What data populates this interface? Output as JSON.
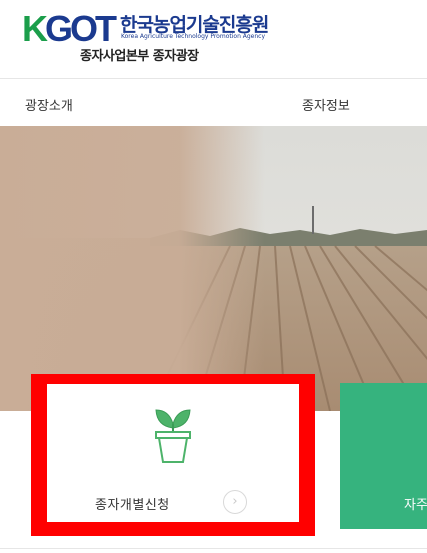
{
  "header": {
    "logo_mark_k": "K",
    "logo_mark_rest": "GOT",
    "org_name_kr": "한국농업기술진흥원",
    "org_name_en": "Korea Agriculture Technology Promotion Agency",
    "subtitle": "종자사업본부 종자광장"
  },
  "nav": {
    "items": [
      {
        "label": "광장소개"
      },
      {
        "label": "종자정보"
      }
    ]
  },
  "cards": [
    {
      "label": "종자개별신청",
      "icon": "seedling-pot-icon",
      "arrow": "›"
    },
    {
      "label": "자주"
    }
  ],
  "colors": {
    "brand_green": "#1b9e4b",
    "brand_blue": "#1b3a8f",
    "highlight_red": "#ff0000",
    "card_green": "#36b37e"
  }
}
